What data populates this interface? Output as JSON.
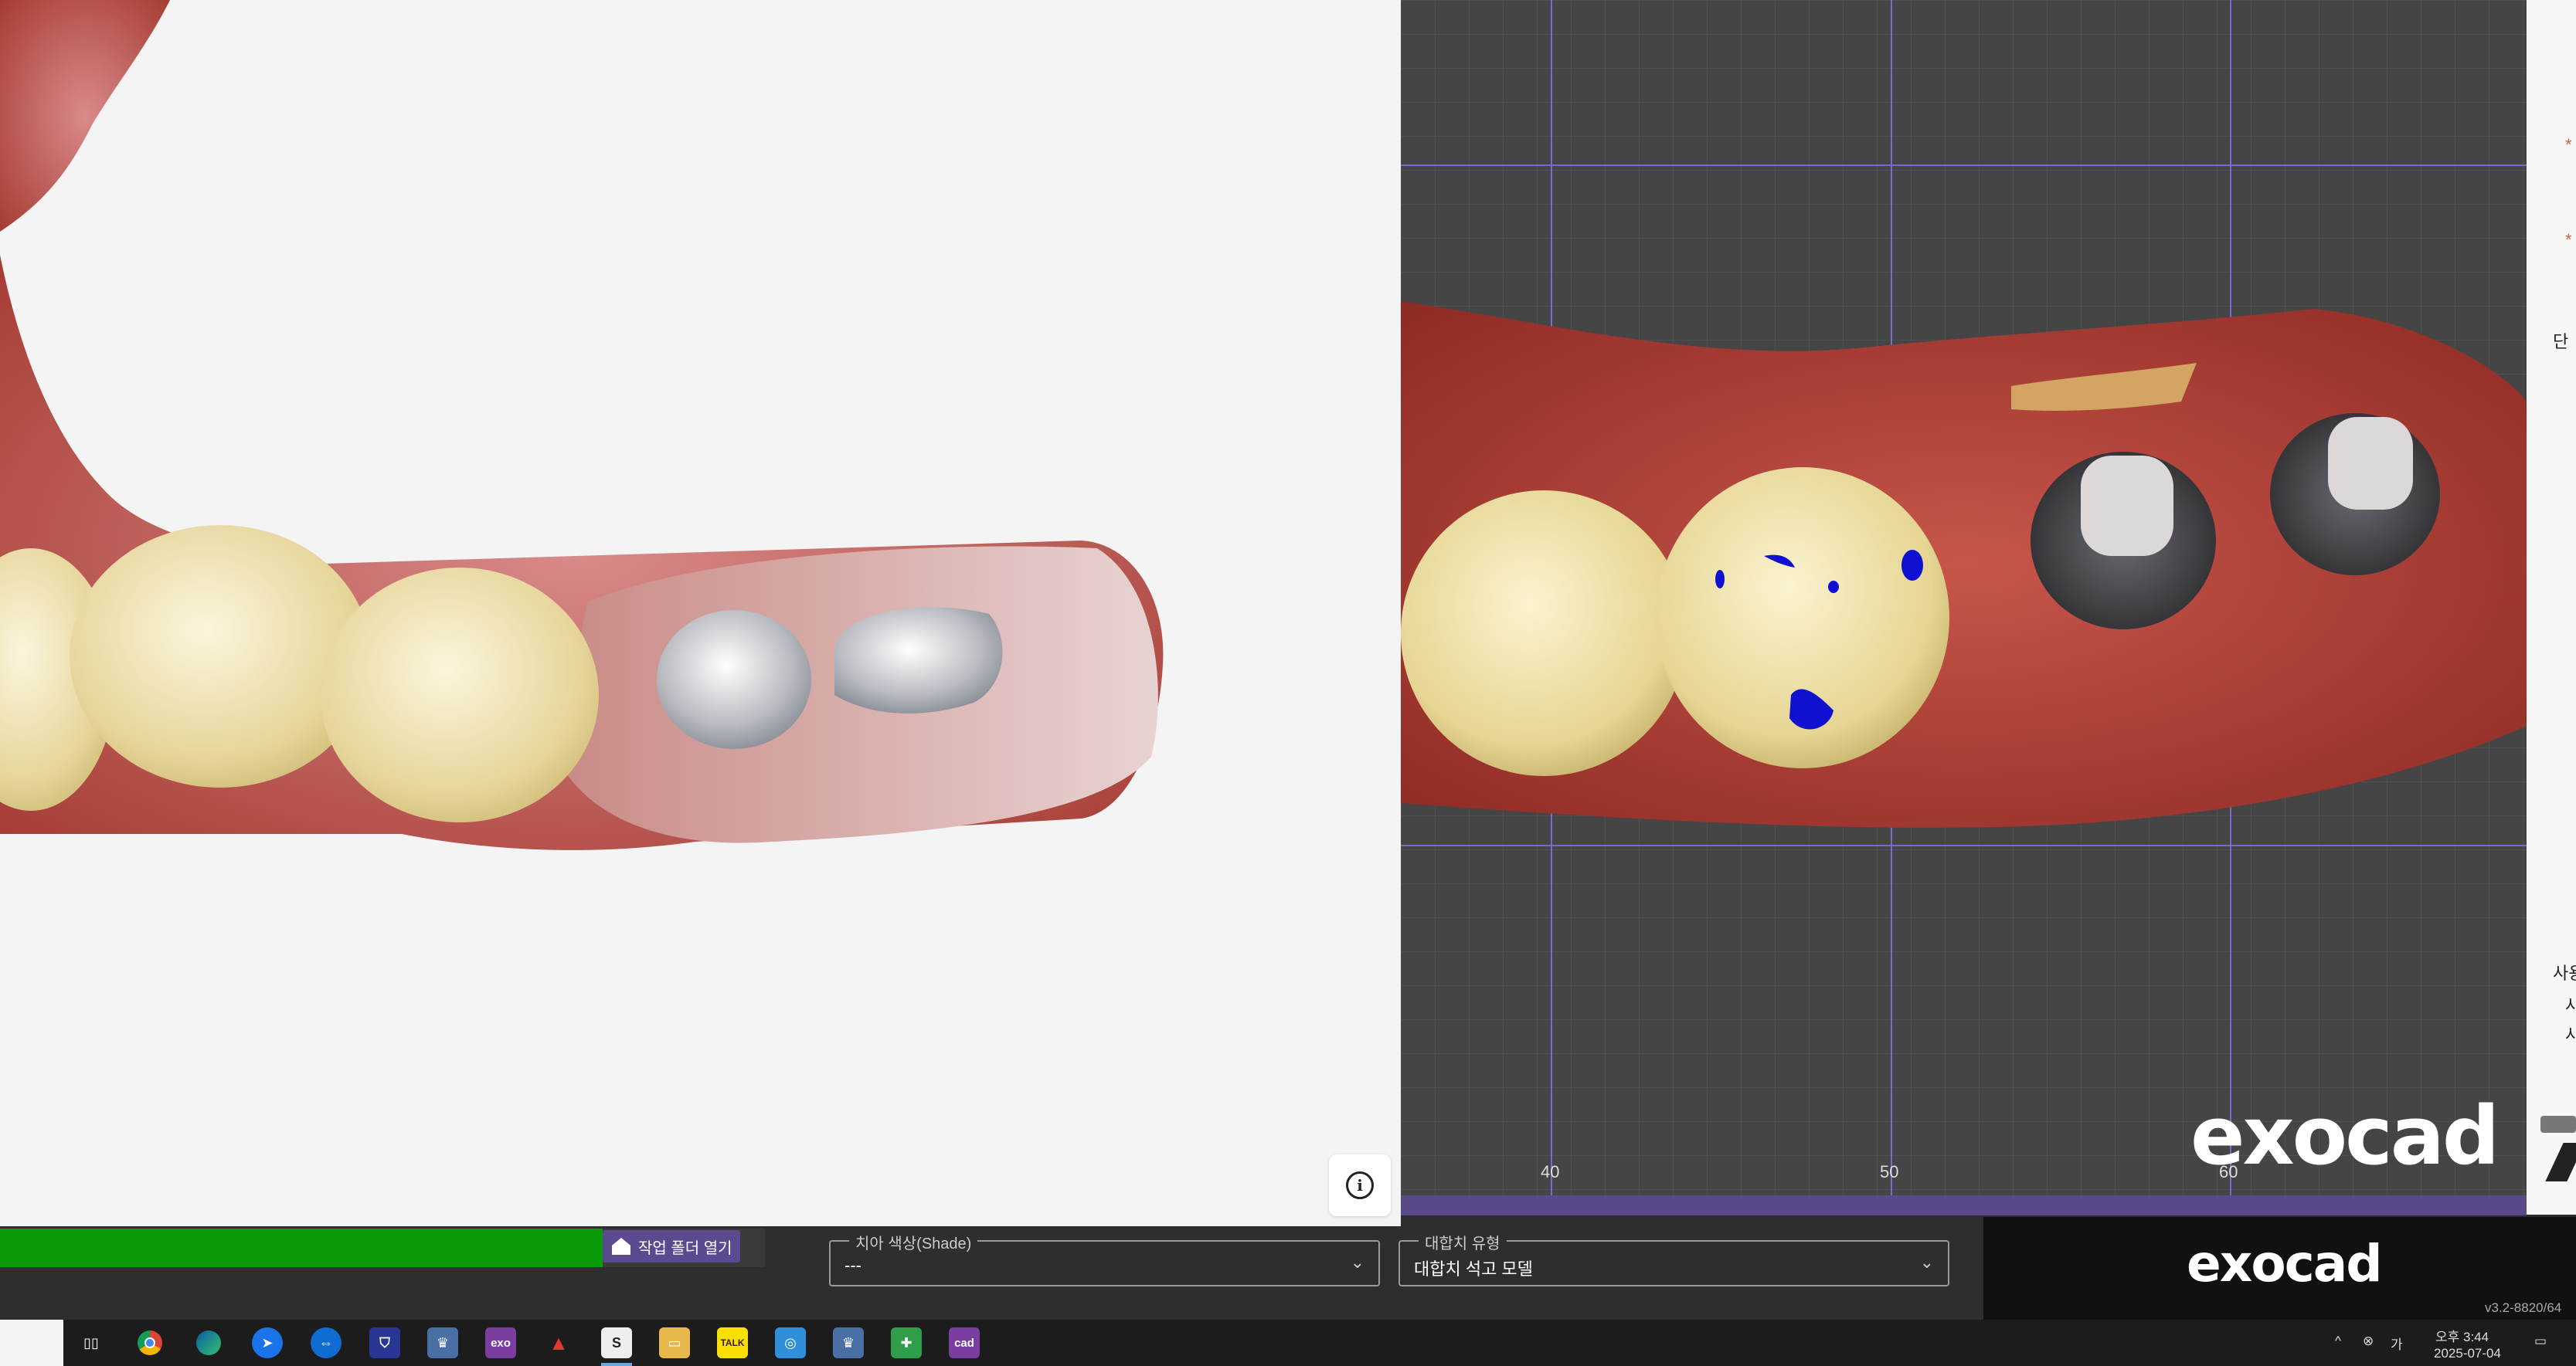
{
  "left_view": {},
  "right_view": {
    "ruler_labels": [
      "40",
      "50",
      "60"
    ],
    "watermark": "exocad"
  },
  "right_strip": {
    "labels": [
      "사용",
      "사",
      "사",
      "단"
    ]
  },
  "bottom": {
    "open_folder_label": "작업 폴더 열기",
    "progress_fraction": 0.79,
    "shade_field": {
      "legend": "치아 색상(Shade)",
      "value": "---"
    },
    "antagonist_field": {
      "legend": "대합치 유형",
      "value": "대합치 석고 모델"
    },
    "logo": "exocad",
    "version": "v3.2-8820/64"
  },
  "taskbar": {
    "apps": [
      "task-view",
      "chrome",
      "edge",
      "app-blue",
      "teamviewer",
      "shield-app",
      "tooth-app",
      "exo",
      "acrobat",
      "s-app",
      "file-explorer",
      "kakaotalk",
      "photos",
      "tooth-app-2",
      "green-app",
      "cad-app"
    ],
    "clock_time": "오후 3:44",
    "clock_date": "2025-07-04"
  },
  "colors": {
    "progress": "#0a9a0a",
    "accent": "#5b4a8f",
    "gum": "#b9443a",
    "tooth": "#e8dda0",
    "abutment": "#c8c8cc"
  }
}
